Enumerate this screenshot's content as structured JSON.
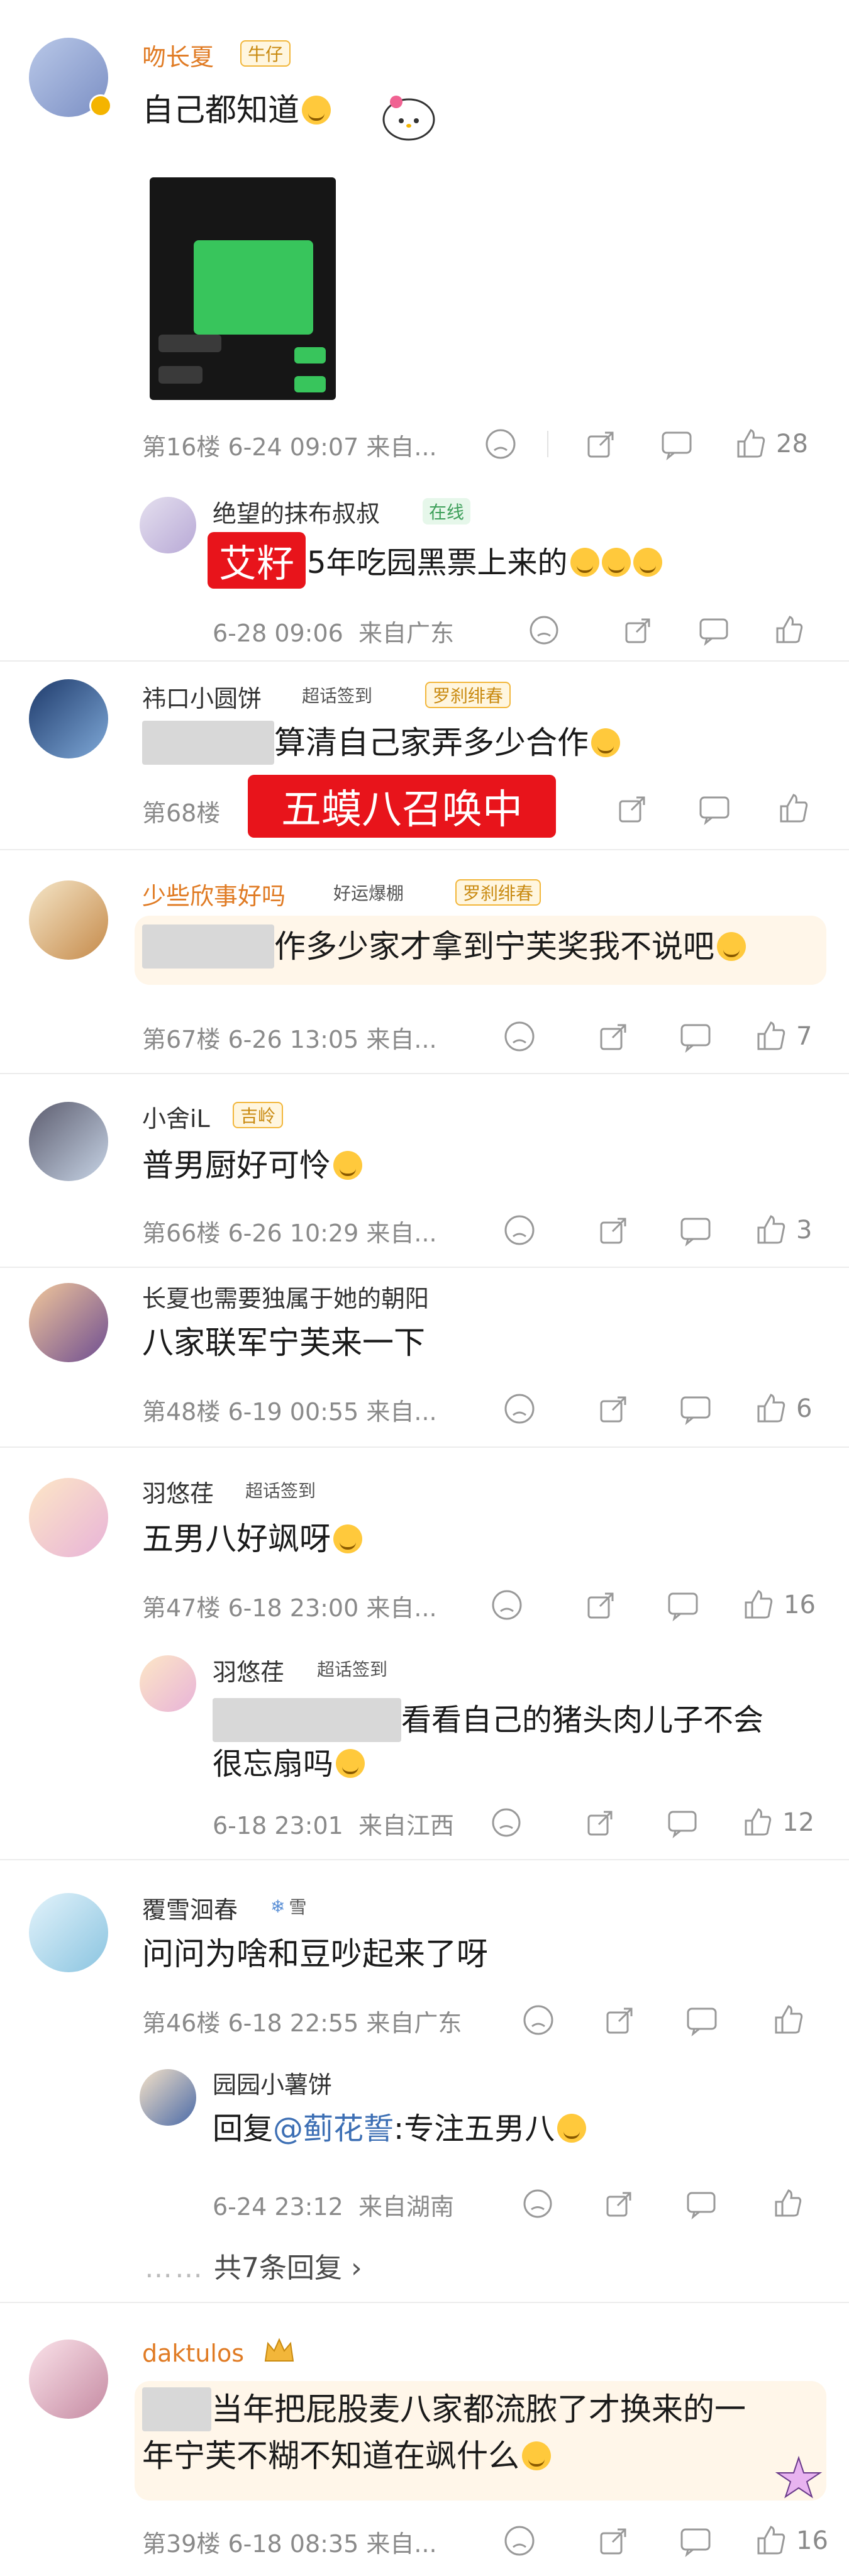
{
  "comments": [
    {
      "name": "吻长夏",
      "badge": "牛仔",
      "text": "自己都知道",
      "floor": "第16楼",
      "time": "6-24 09:07",
      "loc": "来自...",
      "likes": "28",
      "replies": [
        {
          "name": "绝望的抹布叔叔",
          "badge": "在线",
          "text": "5年吃园黑票上来的",
          "time": "6-28 09:06",
          "loc": "来自广东"
        }
      ]
    },
    {
      "name": "祎口小圆饼",
      "badge1": "超话签到",
      "badge2": "罗刹绯春",
      "text": "算清自己家弄多少合作",
      "floor": "第68楼",
      "likes": ""
    },
    {
      "name": "少些欣事好吗",
      "badge1": "好运爆棚",
      "badge2": "罗刹绯春",
      "text": "作多少家才拿到宁芙奖我不说吧",
      "floor": "第67楼",
      "time": "6-26 13:05",
      "loc": "来自...",
      "likes": "7"
    },
    {
      "name": "小舍iL",
      "badge": "吉岭",
      "text": "普男厨好可怜",
      "floor": "第66楼",
      "time": "6-26 10:29",
      "loc": "来自...",
      "likes": "3"
    },
    {
      "name": "长夏也需要独属于她的朝阳",
      "text": "八家联军宁芙来一下",
      "floor": "第48楼",
      "time": "6-19 00:55",
      "loc": "来自...",
      "likes": "6"
    },
    {
      "name": "羽悠荏",
      "badge": "超话签到",
      "text": "五男八好飒呀",
      "floor": "第47楼",
      "time": "6-18 23:00",
      "loc": "来自...",
      "likes": "16",
      "replies": [
        {
          "name": "羽悠荏",
          "badge": "超话签到",
          "text1": "看看自己的猪头肉儿子不会",
          "text2": "很忘扇吗",
          "time": "6-18 23:01",
          "loc": "来自江西",
          "likes": "12"
        }
      ]
    },
    {
      "name": "覆雪洄春",
      "badge": "雪",
      "text": "问问为啥和豆吵起来了呀",
      "floor": "第46楼",
      "time": "6-18 22:55",
      "loc": "来自广东",
      "likes": "",
      "replies": [
        {
          "name": "园园小薯饼",
          "text_prefix": "回复",
          "mention": "@蓟花誓",
          "text": ":专注五男八",
          "time": "6-24 23:12",
          "loc": "来自湖南"
        }
      ],
      "more_replies": "共7条回复"
    },
    {
      "name": "daktulos",
      "text1": "当年把屁股麦八家都流脓了才换来的一",
      "text2": "年宁芙不糊不知道在飒什么",
      "floor": "第39楼",
      "time": "6-18 08:35",
      "loc": "来自...",
      "likes": "16"
    }
  ],
  "overlays": {
    "red_label_1": "艾籽",
    "red_label_2": "五蟆八召唤中"
  },
  "colors": {
    "accent_name": "#e07b24",
    "link": "#3d6fb4",
    "red_label": "#e8141b"
  }
}
